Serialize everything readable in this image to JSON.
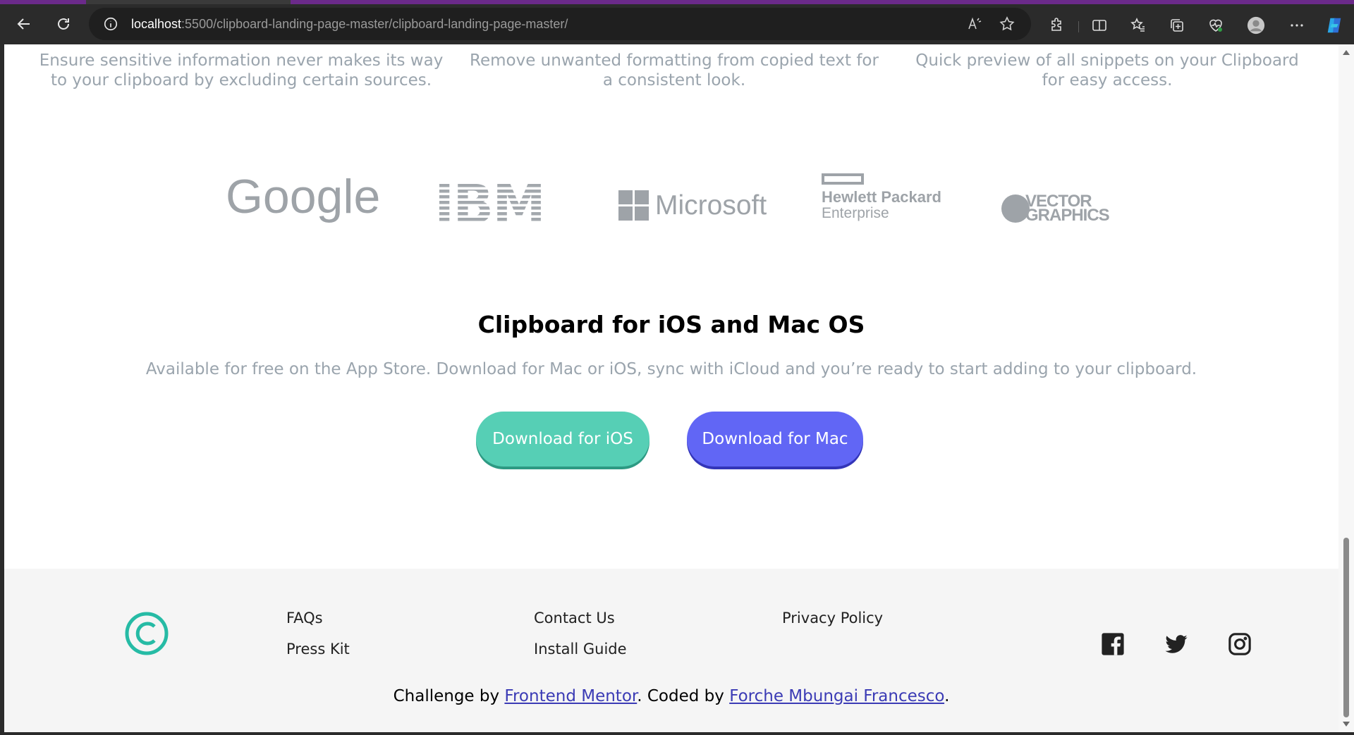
{
  "browser": {
    "url_host": "localhost",
    "url_path": ":5500/clipboard-landing-page-master/clipboard-landing-page-master/",
    "icons": [
      "back-icon",
      "refresh-icon",
      "info-icon",
      "read-aloud-icon",
      "favorite-star-icon",
      "extensions-icon",
      "split-screen-icon",
      "favorites-icon",
      "collections-icon",
      "health-icon",
      "profile-icon",
      "more-icon",
      "copilot-icon"
    ]
  },
  "features": [
    {
      "text": "Ensure sensitive information never makes its way to your clipboard by excluding certain sources."
    },
    {
      "text": "Remove unwanted formatting from copied text for a consistent look."
    },
    {
      "text": "Quick preview of all snippets on your Clipboard for easy access."
    }
  ],
  "logos": {
    "google": "Google",
    "ibm": "IBM",
    "microsoft": "Microsoft",
    "hp_line1": "Hewlett Packard",
    "hp_line2": "Enterprise",
    "vector_line1": "VECTOR",
    "vector_line2": "GRAPHICS"
  },
  "cta": {
    "title": "Clipboard for iOS and Mac OS",
    "text": "Available for free on the App Store. Download for Mac or iOS, sync with iCloud and you’re ready to start adding to your clipboard.",
    "ios_button": "Download for iOS",
    "mac_button": "Download for Mac"
  },
  "footer": {
    "links": {
      "faqs": "FAQs",
      "press_kit": "Press Kit",
      "contact_us": "Contact Us",
      "install_guide": "Install Guide",
      "privacy_policy": "Privacy Policy"
    },
    "credit": {
      "prefix": "Challenge by ",
      "link1": "Frontend Mentor",
      "middle": ". Coded by ",
      "link2": "Forche Mbungai Francesco",
      "suffix": "."
    },
    "social": [
      "facebook-icon",
      "twitter-icon",
      "instagram-icon"
    ]
  },
  "colors": {
    "accent_teal": "#56cfb5",
    "accent_blue": "#6166f5",
    "text_gray": "#9aa4ad"
  }
}
